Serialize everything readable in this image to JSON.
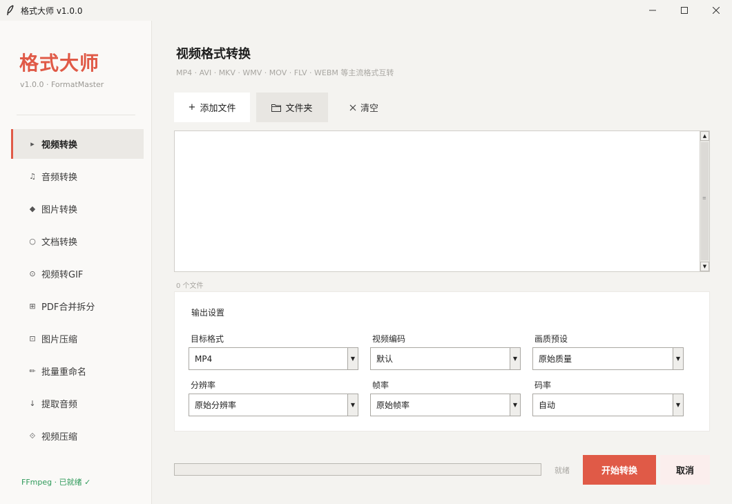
{
  "window": {
    "title": "格式大师 v1.0.0",
    "controls": [
      "minimize-icon",
      "maximize-icon",
      "close-icon"
    ]
  },
  "sidebar": {
    "brand": "格式大师",
    "version": "v1.0.0 · FormatMaster",
    "items": [
      {
        "icon": "play-icon",
        "label": "视频转换",
        "active": true
      },
      {
        "icon": "music-note-icon",
        "label": "音频转换",
        "active": false
      },
      {
        "icon": "diamond-icon",
        "label": "图片转换",
        "active": false
      },
      {
        "icon": "circle-icon",
        "label": "文档转换",
        "active": false
      },
      {
        "icon": "target-icon",
        "label": "视频转GIF",
        "active": false
      },
      {
        "icon": "grid-icon",
        "label": "PDF合并拆分",
        "active": false
      },
      {
        "icon": "square-icon",
        "label": "图片压缩",
        "active": false
      },
      {
        "icon": "pencil-icon",
        "label": "批量重命名",
        "active": false
      },
      {
        "icon": "down-arrow-icon",
        "label": "提取音频",
        "active": false
      },
      {
        "icon": "rhombus-icon",
        "label": "视频压缩",
        "active": false
      }
    ],
    "status": "FFmpeg · 已就绪 ✓"
  },
  "main": {
    "title": "视频格式转换",
    "subtitle": "MP4 · AVI · MKV · WMV · MOV · FLV · WEBM 等主流格式互转",
    "toolbar": {
      "add_label": "添加文件",
      "folder_label": "文件夹",
      "clear_label": "清空"
    },
    "file_count": "0 个文件",
    "settings": {
      "title": "输出设置",
      "fields": [
        {
          "label": "目标格式",
          "value": "MP4"
        },
        {
          "label": "视频编码",
          "value": "默认"
        },
        {
          "label": "画质预设",
          "value": "原始质量"
        },
        {
          "label": "分辨率",
          "value": "原始分辨率"
        },
        {
          "label": "帧率",
          "value": "原始帧率"
        },
        {
          "label": "码率",
          "value": "自动"
        }
      ]
    },
    "progress": 0,
    "status": "就绪",
    "start_label": "开始转换",
    "cancel_label": "取消"
  },
  "colors": {
    "accent": "#e05a47",
    "success": "#2e9a5a",
    "active_bg": "#ebe9e5"
  }
}
